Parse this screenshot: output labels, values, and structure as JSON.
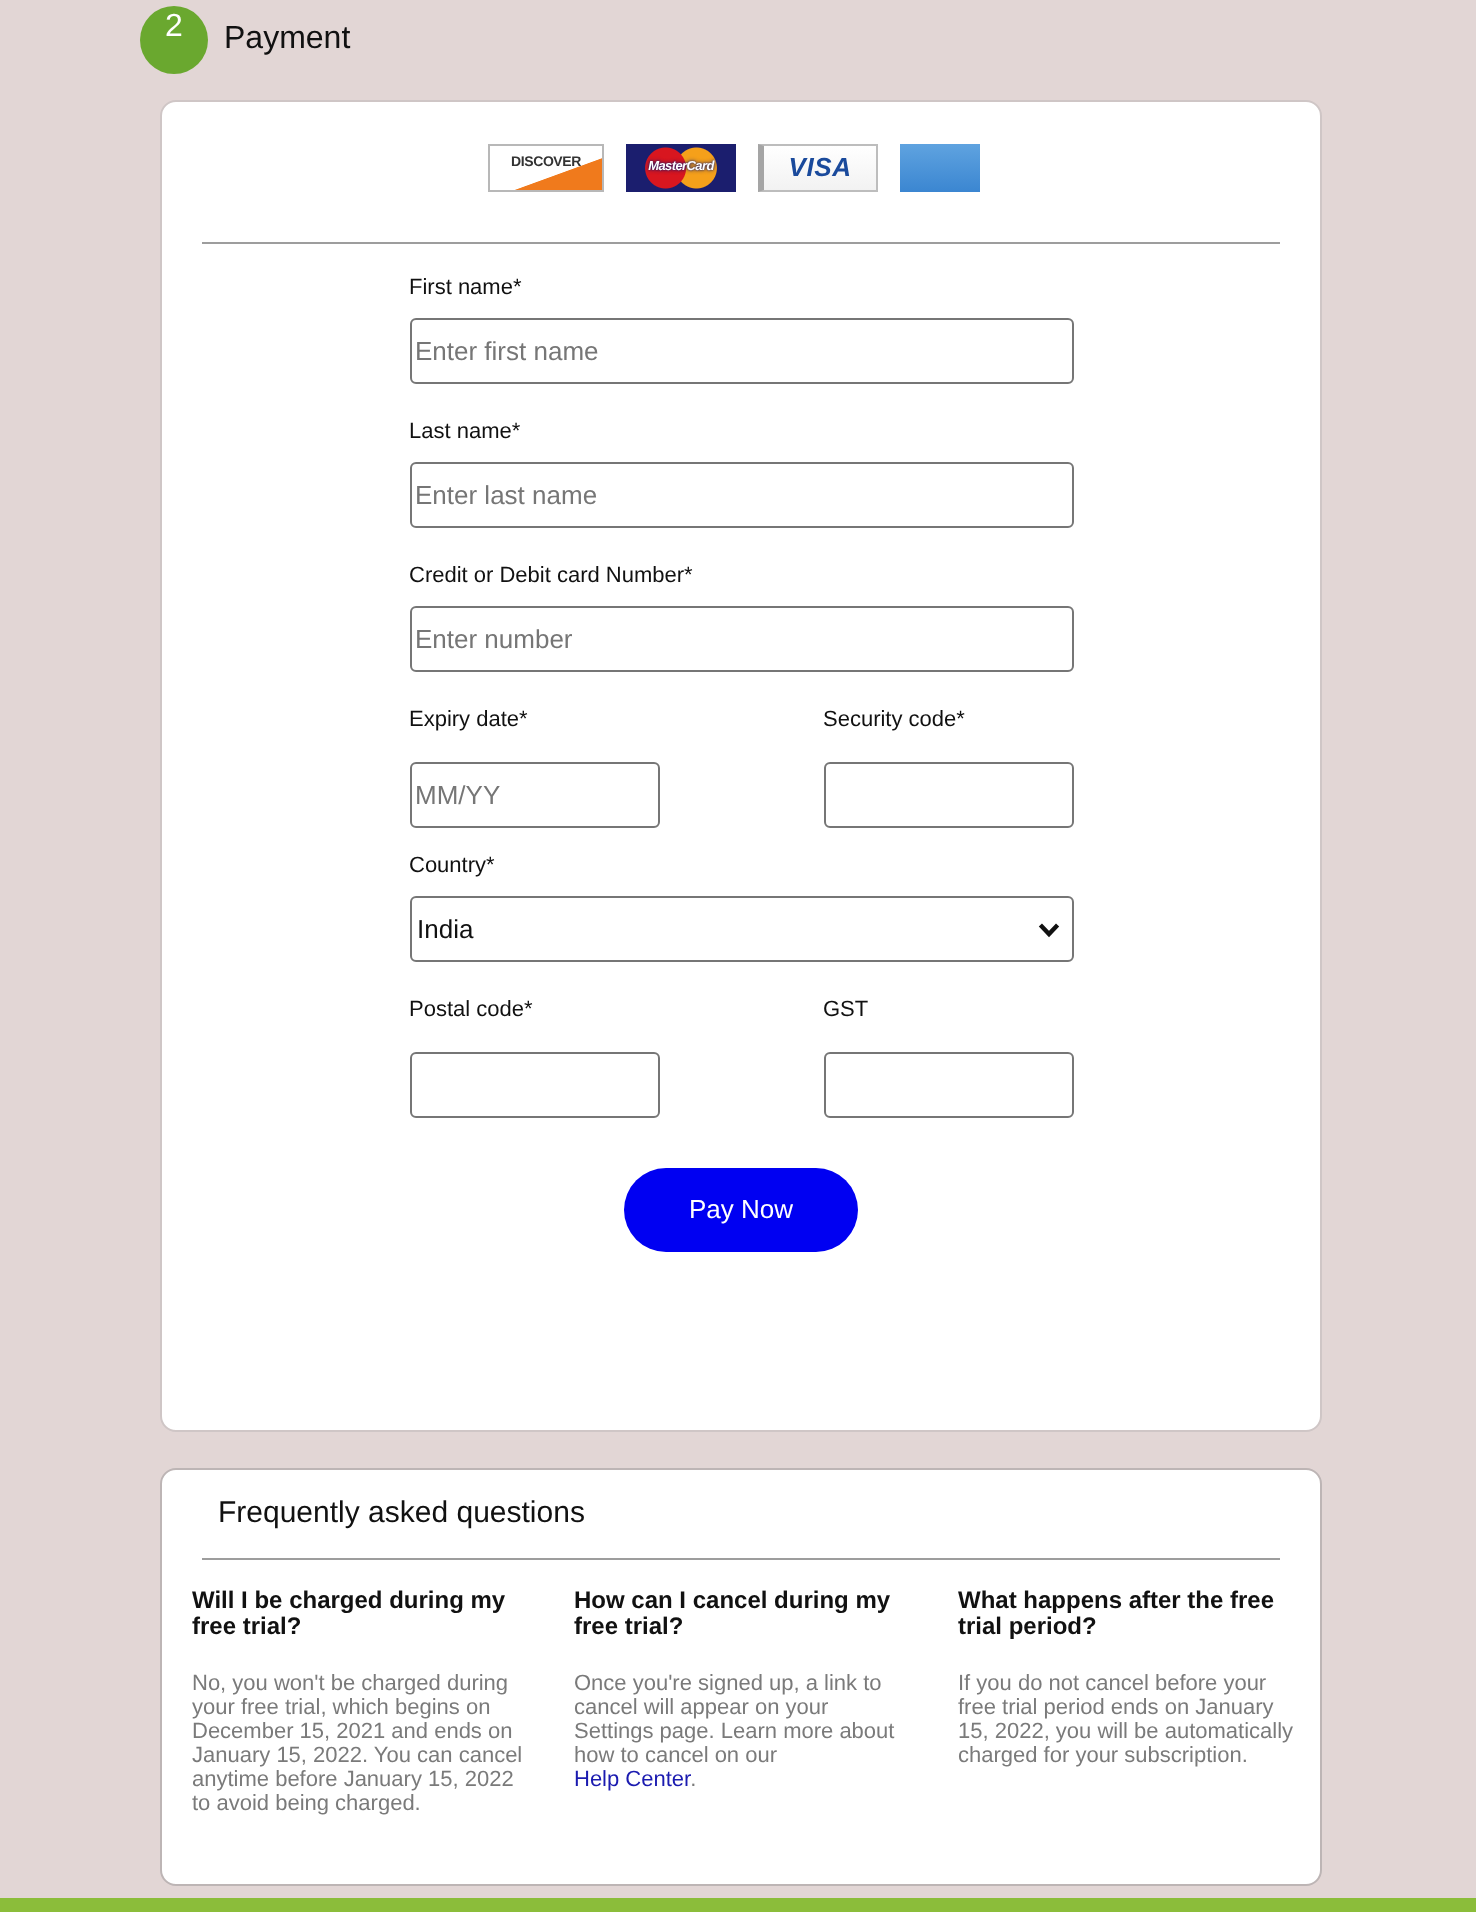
{
  "step": {
    "number": "2",
    "title": "Payment"
  },
  "card_logos": [
    {
      "kind": "discover",
      "label": "DISCOVER"
    },
    {
      "kind": "mastercard",
      "label": "MasterCard"
    },
    {
      "kind": "visa",
      "label": "VISA"
    },
    {
      "kind": "amex"
    }
  ],
  "form_rows": [
    {
      "fields": [
        {
          "kind": "text",
          "label": "First name*",
          "placeholder": "Enter first name"
        }
      ]
    },
    {
      "fields": [
        {
          "kind": "text",
          "label": "Last name*",
          "placeholder": "Enter last name"
        }
      ]
    },
    {
      "fields": [
        {
          "kind": "text",
          "label": "Credit or Debit card Number*",
          "placeholder": "Enter number"
        }
      ]
    },
    {
      "fields": [
        {
          "kind": "text",
          "label": "Expiry date*",
          "placeholder": "MM/YY"
        },
        {
          "kind": "text",
          "label": "Security code*"
        }
      ]
    },
    {
      "fields": [
        {
          "kind": "select",
          "label": "Country*",
          "value": "India"
        }
      ]
    },
    {
      "fields": [
        {
          "kind": "text",
          "label": "Postal code*"
        },
        {
          "kind": "text",
          "label": "GST"
        }
      ]
    }
  ],
  "pay_button": {
    "label": "Pay Now"
  },
  "faq": {
    "title": "Frequently asked questions",
    "items": [
      {
        "question": "Will I be charged during my free trial?",
        "answer": "No, you won't be charged during your free trial, which begins on December 15, 2021 and ends on January 15, 2022. You can cancel anytime before January 15, 2022 to avoid being charged."
      },
      {
        "question": "How can I cancel during my free trial?",
        "answer": "Once you're signed up, a link to cancel will appear on your Settings page. Learn more about how to cancel on our",
        "link": "Help Center",
        "answer_end": "."
      },
      {
        "question": "What happens after the free trial period?",
        "answer": "If you do not cancel before your free trial period ends on January 15, 2022, you will be automatically charged for your subscription."
      }
    ]
  }
}
